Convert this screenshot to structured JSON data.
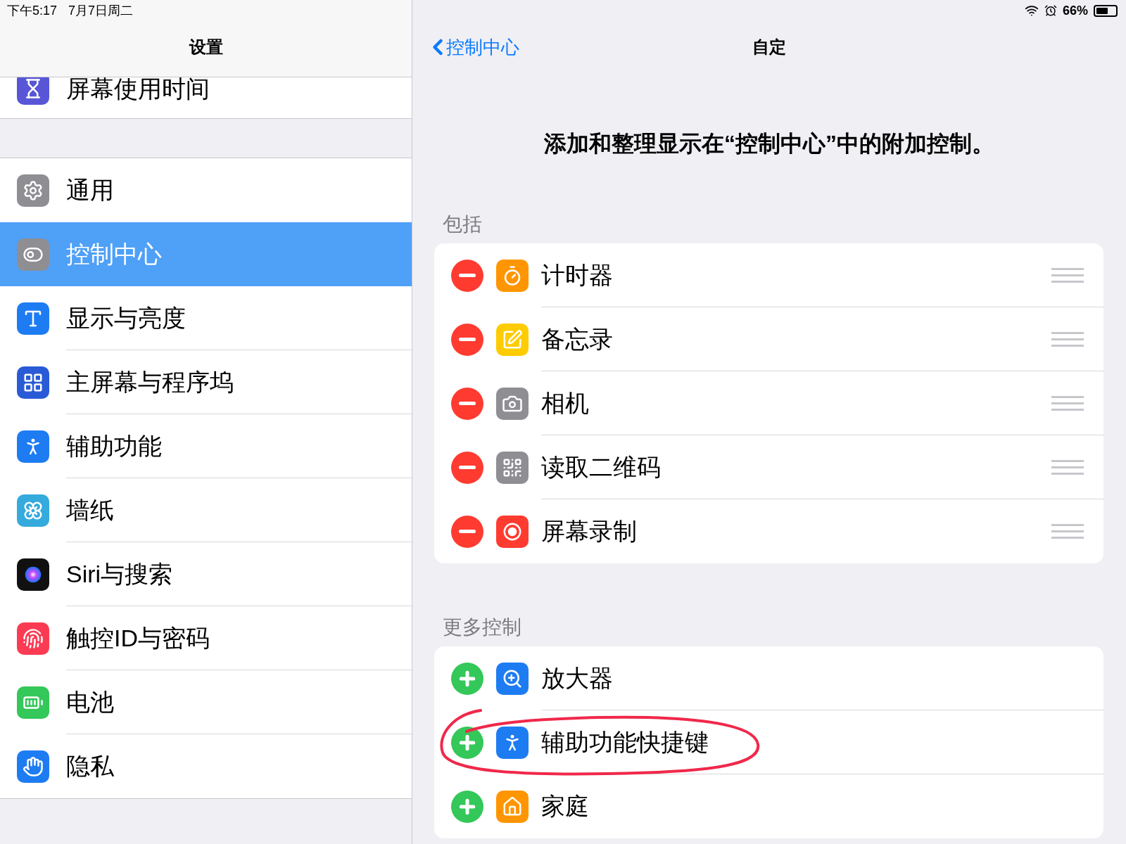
{
  "status_bar": {
    "time": "下午5:17",
    "date": "7月7日周二",
    "battery": "66%"
  },
  "sidebar": {
    "title": "设置",
    "groups": [
      {
        "items": [
          {
            "label": "屏幕使用时间",
            "selected": false
          }
        ]
      },
      {
        "items": [
          {
            "label": "通用",
            "selected": false
          },
          {
            "label": "控制中心",
            "selected": true
          },
          {
            "label": "显示与亮度",
            "selected": false
          },
          {
            "label": "主屏幕与程序坞",
            "selected": false
          },
          {
            "label": "辅助功能",
            "selected": false
          },
          {
            "label": "墙纸",
            "selected": false
          },
          {
            "label": "Siri与搜索",
            "selected": false
          },
          {
            "label": "触控ID与密码",
            "selected": false
          },
          {
            "label": "电池",
            "selected": false
          },
          {
            "label": "隐私",
            "selected": false
          }
        ]
      }
    ]
  },
  "detail": {
    "back": "控制中心",
    "title": "自定",
    "description": "添加和整理显示在“控制中心”中的附加控制。",
    "sections": [
      {
        "header": "包括",
        "items": [
          {
            "label": "计时器",
            "kind": "remove",
            "circled": false
          },
          {
            "label": "备忘录",
            "kind": "remove",
            "circled": false
          },
          {
            "label": "相机",
            "kind": "remove",
            "circled": false
          },
          {
            "label": "读取二维码",
            "kind": "remove",
            "circled": false
          },
          {
            "label": "屏幕录制",
            "kind": "remove",
            "circled": false
          }
        ]
      },
      {
        "header": "更多控制",
        "items": [
          {
            "label": "放大器",
            "kind": "add",
            "circled": false
          },
          {
            "label": "辅助功能快捷键",
            "kind": "add",
            "circled": true
          },
          {
            "label": "家庭",
            "kind": "add",
            "circled": false
          }
        ]
      }
    ]
  }
}
